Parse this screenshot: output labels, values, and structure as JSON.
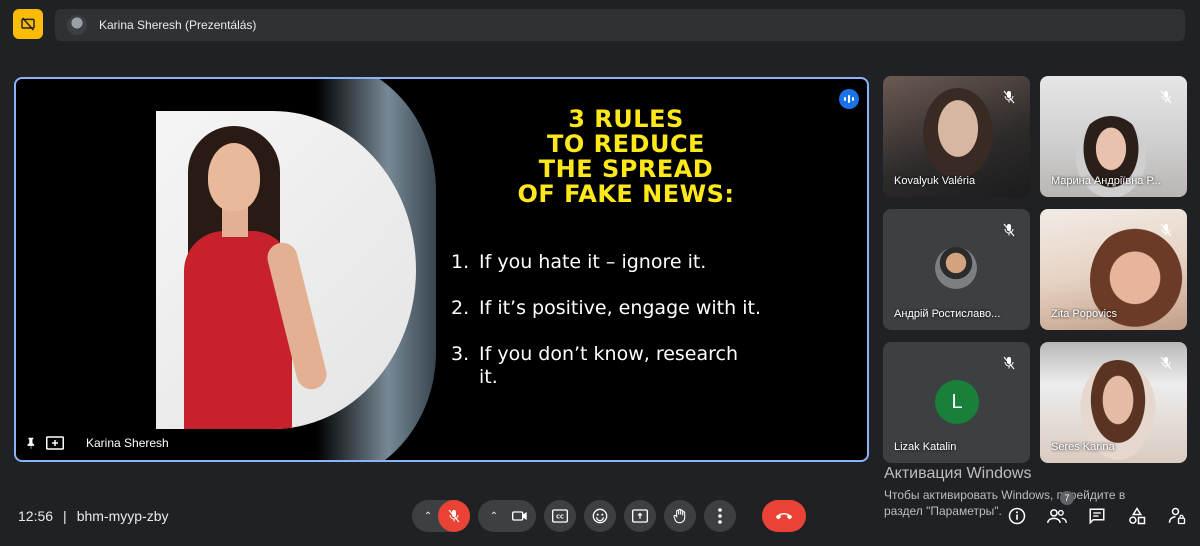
{
  "topbar": {
    "presenter_label": "Karina Sheresh (Prezentálás)"
  },
  "slide": {
    "title_lines": [
      "3 RULES",
      "TO REDUCE",
      "THE SPREAD",
      "OF FAKE NEWS:"
    ],
    "rules": [
      {
        "num": "1.",
        "text": "If you hate it – ignore it."
      },
      {
        "num": "2.",
        "text": "If it’s positive, engage with it."
      },
      {
        "num": "3.",
        "text": "If you don’t know, research it."
      }
    ],
    "title_color": "#ffe81a"
  },
  "stage": {
    "presenter_name": "Karina Sheresh"
  },
  "participants": [
    {
      "name": "Kovalyuk Valéria"
    },
    {
      "name": "Марина Андріївна Р..."
    },
    {
      "name": "Андрій Ростиславо..."
    },
    {
      "name": "Zita Popovics"
    },
    {
      "name": "Lizak Katalin",
      "initial": "L"
    },
    {
      "name": "Seres Karina"
    }
  ],
  "activation": {
    "title": "Активация Windows",
    "line1": "Чтобы активировать Windows, перейдите в",
    "line2": "раздел \"Параметры\"."
  },
  "bottombar": {
    "time": "12:56",
    "separator": "|",
    "meeting_code": "bhm-myyp-zby",
    "people_count": "7"
  },
  "colors": {
    "accent": "#8ab4f8",
    "danger": "#ea4335",
    "present_badge": "#fbbc04"
  }
}
